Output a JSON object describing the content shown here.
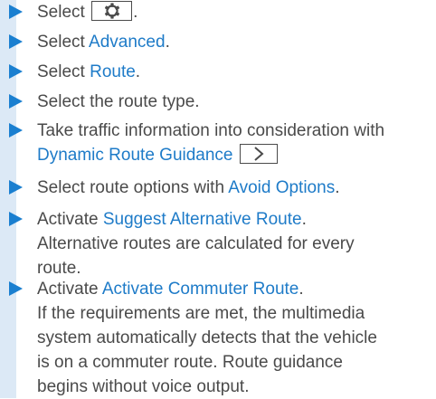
{
  "steps": [
    {
      "before": "Select ",
      "after": "."
    },
    {
      "before": "Select ",
      "link": "Advanced",
      "after": "."
    },
    {
      "before": "Select ",
      "link": "Route",
      "after": "."
    },
    {
      "text": "Select the route type."
    },
    {
      "line1": "Take traffic information into consideration with",
      "link": "Dynamic Route Guidance"
    },
    {
      "before": "Select route options with ",
      "link": "Avoid Options",
      "after": "."
    },
    {
      "before": "Activate ",
      "link": "Suggest Alternative Route",
      "after": ".",
      "line2": "Alternative routes are calculated for every",
      "line3": "route."
    },
    {
      "before": "Activate ",
      "link": "Activate Commuter Route",
      "after": ".",
      "line2": "If the requirements are met, the multimedia",
      "line3": "system automatically detects that the vehicle",
      "line4": "is on a commuter route. Route guidance",
      "line5": "begins without voice output."
    }
  ],
  "icons": {
    "settings_key": "gear-icon",
    "next_key": "chevron-right-icon"
  },
  "colors": {
    "rail": "#dce9f6",
    "arrow": "#1a7fd0",
    "link": "#1e7bc8",
    "text": "#4a4a4a"
  }
}
